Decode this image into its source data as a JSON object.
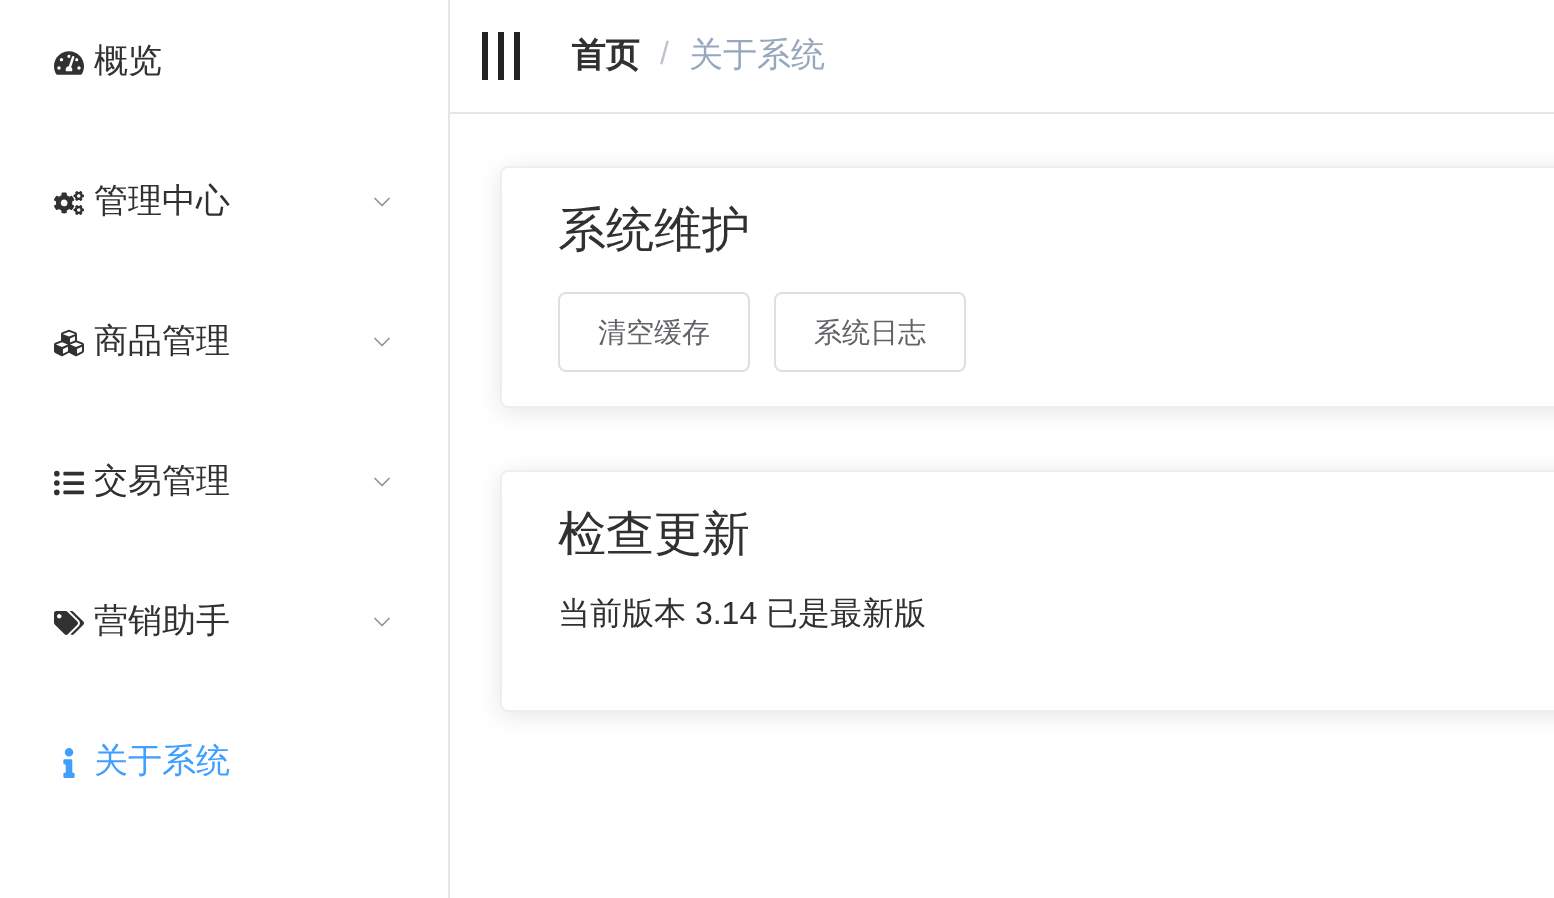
{
  "sidebar": {
    "items": [
      {
        "label": "概览",
        "selected": false
      },
      {
        "label": "管理中心",
        "selected": false,
        "expanded": false
      },
      {
        "label": "商品管理",
        "selected": false,
        "expanded": false
      },
      {
        "label": "交易管理",
        "selected": false,
        "expanded": false
      },
      {
        "label": "营销助手",
        "selected": false,
        "expanded": false
      },
      {
        "label": "关于系统",
        "selected": true
      }
    ]
  },
  "breadcrumb": [
    {
      "label": "首页",
      "selected": false
    },
    {
      "label": "关于系统",
      "selected": true
    }
  ],
  "breadcrumb_separator": "/",
  "cards": [
    {
      "title": "系统维护",
      "kind": "buttons",
      "buttons": [
        "清空缓存",
        "系统日志"
      ]
    },
    {
      "title": "检查更新",
      "kind": "text",
      "text": "当前版本 3.14 已是最新版"
    }
  ]
}
